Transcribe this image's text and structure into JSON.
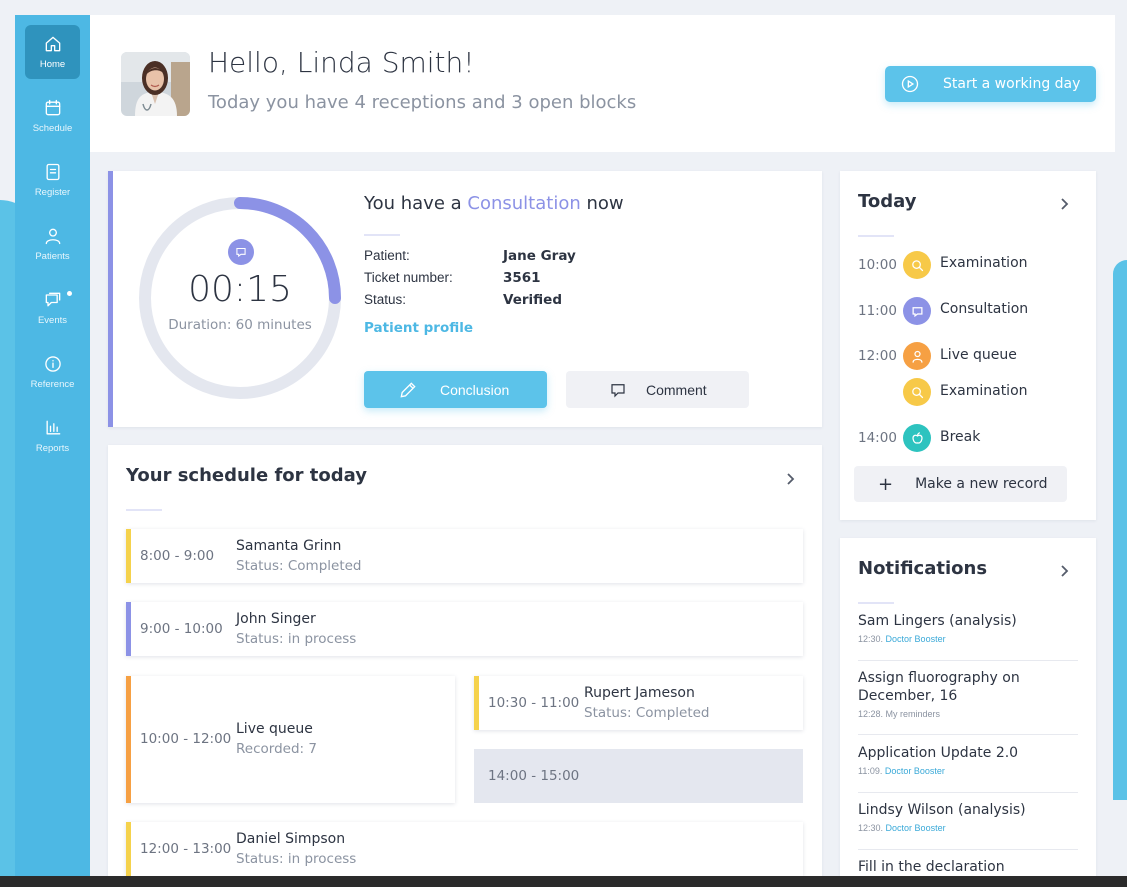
{
  "sidebar": {
    "items": [
      {
        "label": "Home",
        "icon": "home-icon"
      },
      {
        "label": "Schedule",
        "icon": "calendar-icon"
      },
      {
        "label": "Register",
        "icon": "document-icon"
      },
      {
        "label": "Patients",
        "icon": "user-icon"
      },
      {
        "label": "Events",
        "icon": "chat-icon"
      },
      {
        "label": "Reference",
        "icon": "info-icon"
      },
      {
        "label": "Reports",
        "icon": "bar-chart-icon"
      }
    ]
  },
  "header": {
    "greeting": "Hello, Linda Smith!",
    "subtitle": "Today you have 4 receptions and 3 open blocks",
    "start_button": "Start a working day"
  },
  "consultation": {
    "title_prefix": "You have a",
    "title_highlight": "Consultation",
    "title_suffix": "now",
    "timer": "00:15",
    "duration": "Duration: 60 minutes",
    "progress": 0.25,
    "fields": [
      {
        "label": "Patient:",
        "value": "Jane Gray"
      },
      {
        "label": "Ticket number:",
        "value": "3561"
      },
      {
        "label": "Status:",
        "value": "Verified"
      }
    ],
    "profile_link": "Patient profile",
    "conclusion_button": "Conclusion",
    "comment_button": "Comment"
  },
  "schedule": {
    "title": "Your schedule for today",
    "slots": [
      {
        "time": "8:00 - 9:00",
        "name": "Samanta Grinn",
        "status": "Status: Completed"
      },
      {
        "time": "9:00 - 10:00",
        "name": "John Singer",
        "status": "Status: in process"
      },
      {
        "time": "10:00 - 12:00",
        "name": "Live queue",
        "status": "Recorded: 7"
      },
      {
        "time": "10:30 - 11:00",
        "name": "Rupert Jameson",
        "status": "Status: Completed"
      },
      {
        "time": "14:00 - 15:00",
        "name": "",
        "status": ""
      },
      {
        "time": "12:00 - 13:00",
        "name": "Daniel Simpson",
        "status": "Status: in process"
      }
    ]
  },
  "today": {
    "title": "Today",
    "items": [
      {
        "time": "10:00",
        "label": "Examination",
        "icon": "search-icon",
        "color": "#f7c948"
      },
      {
        "time": "11:00",
        "label": "Consultation",
        "icon": "chat-icon",
        "color": "#8c92e6"
      },
      {
        "time": "12:00",
        "label": "Live queue",
        "icon": "user-icon",
        "color": "#f6a043"
      },
      {
        "time": "",
        "label": "Examination",
        "icon": "search-icon",
        "color": "#f7c948"
      },
      {
        "time": "14:00",
        "label": "Break",
        "icon": "apple-icon",
        "color": "#2dc3bf"
      }
    ],
    "new_record": "Make a new record",
    "plus": "+"
  },
  "notifications": {
    "title": "Notifications",
    "items": [
      {
        "title": "Sam Lingers (analysis)",
        "time": "12:30.",
        "source": "Doctor Booster"
      },
      {
        "title": "Assign fluorography on December, 16",
        "time": "12:28.",
        "source": "My reminders"
      },
      {
        "title": "Application Update 2.0",
        "time": "11:09.",
        "source": "Doctor Booster"
      },
      {
        "title": "Lindsy Wilson (analysis)",
        "time": "12:30.",
        "source": "Doctor Booster"
      },
      {
        "title": "Fill in the declaration",
        "time": "",
        "source": ""
      }
    ]
  },
  "colors": {
    "sidebar": "#4db8e4",
    "accent": "#5cc3ea",
    "purple": "#8c92e6",
    "yellow": "#f5d24c",
    "orange": "#f6a043"
  }
}
